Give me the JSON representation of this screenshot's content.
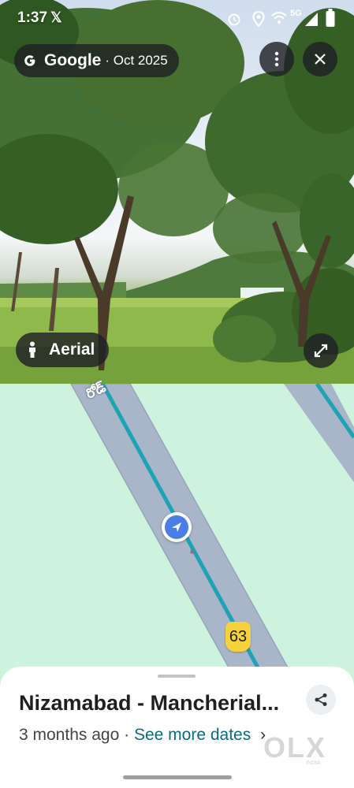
{
  "status_bar": {
    "time": "1:37",
    "x_logo": "𝕏",
    "network": "5G"
  },
  "photo_header": {
    "brand": "Google",
    "date": "· Oct 2025"
  },
  "photo_controls": {
    "aerial_label": "Aerial"
  },
  "map": {
    "route_shield": "63",
    "road_label": "రోడ్"
  },
  "sheet": {
    "title": "Nizamabad - Mancherial...",
    "age": "3 months ago",
    "separator": "·",
    "see_more": "See more dates",
    "chevron": "›"
  },
  "watermark": {
    "brand": "OLX",
    "region": "INDIA"
  },
  "colors": {
    "map_bg": "#cdf3df",
    "road": "#a8b4c8",
    "route": "#1ea3b5",
    "shield": "#f5d23c",
    "accent": "#0b6c7f"
  }
}
